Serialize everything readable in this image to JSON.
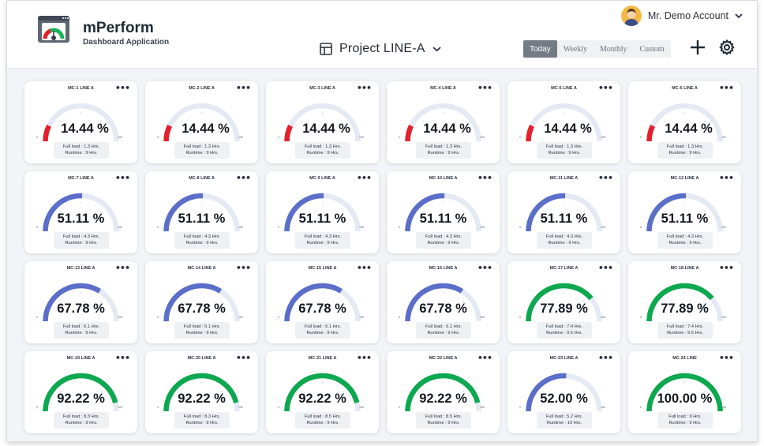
{
  "app": {
    "name": "mPerform",
    "subtitle": "Dashboard Application"
  },
  "account": {
    "name": "Mr. Demo Account",
    "icon": "avatar-icon"
  },
  "project": {
    "name": "Project LINE-A",
    "icon": "layout-icon"
  },
  "range_tabs": [
    "Today",
    "Weekly",
    "Monthly",
    "Custom"
  ],
  "active_range": "Today",
  "colors": {
    "accent_blue": "#5b6ec9",
    "green": "#0da84f",
    "red": "#e3202b",
    "track": "#e4e9f4",
    "page_bg": "#f2f4f7"
  },
  "gauge_scale": {
    "min_label": "0",
    "max_label": "100"
  },
  "cards": [
    {
      "title": "MC-1 LINE A",
      "percent_label": "14.44 %",
      "value": 14.44,
      "color": "red",
      "full_load": "Full load : 1.3 Hrs.",
      "runtime": "Runtime : 9 Hrs."
    },
    {
      "title": "MC-2 LINE A",
      "percent_label": "14.44 %",
      "value": 14.44,
      "color": "red",
      "full_load": "Full load : 1.3 Hrs.",
      "runtime": "Runtime : 9 Hrs."
    },
    {
      "title": "MC-3 LINE A",
      "percent_label": "14.44 %",
      "value": 14.44,
      "color": "red",
      "full_load": "Full load : 1.3 Hrs.",
      "runtime": "Runtime : 9 Hrs."
    },
    {
      "title": "MC-4 LINE A",
      "percent_label": "14.44 %",
      "value": 14.44,
      "color": "red",
      "full_load": "Full load : 1.3 Hrs.",
      "runtime": "Runtime : 9 Hrs."
    },
    {
      "title": "MC-5 LINE A",
      "percent_label": "14.44 %",
      "value": 14.44,
      "color": "red",
      "full_load": "Full load : 1.3 Hrs.",
      "runtime": "Runtime : 9 Hrs."
    },
    {
      "title": "MC-6 LINE A",
      "percent_label": "14.44 %",
      "value": 14.44,
      "color": "red",
      "full_load": "Full load : 1.3 Hrs.",
      "runtime": "Runtime : 9 Hrs."
    },
    {
      "title": "MC-7 LINE A",
      "percent_label": "51.11 %",
      "value": 51.11,
      "color": "blue",
      "full_load": "Full load : 4.3 Hrs.",
      "runtime": "Runtime : 9 Hrs."
    },
    {
      "title": "MC-8 LINE A",
      "percent_label": "51.11 %",
      "value": 51.11,
      "color": "blue",
      "full_load": "Full load : 4.3 Hrs.",
      "runtime": "Runtime : 9 Hrs."
    },
    {
      "title": "MC-9 LINE A",
      "percent_label": "51.11 %",
      "value": 51.11,
      "color": "blue",
      "full_load": "Full load : 4.3 Hrs.",
      "runtime": "Runtime : 9 Hrs."
    },
    {
      "title": "MC-10 LINE A",
      "percent_label": "51.11 %",
      "value": 51.11,
      "color": "blue",
      "full_load": "Full load : 4.3 Hrs.",
      "runtime": "Runtime : 9 Hrs."
    },
    {
      "title": "MC-11 LINE A",
      "percent_label": "51.11 %",
      "value": 51.11,
      "color": "blue",
      "full_load": "Full load : 4.3 Hrs.",
      "runtime": "Runtime : 9 Hrs."
    },
    {
      "title": "MC-12 LINE A",
      "percent_label": "51.11 %",
      "value": 51.11,
      "color": "blue",
      "full_load": "Full load : 4.3 Hrs.",
      "runtime": "Runtime : 9 Hrs."
    },
    {
      "title": "MC-13 LINE A",
      "percent_label": "67.78 %",
      "value": 67.78,
      "color": "blue",
      "full_load": "Full load : 6.1 Hrs.",
      "runtime": "Runtime : 9 Hrs."
    },
    {
      "title": "MC-14 LINE A",
      "percent_label": "67.78 %",
      "value": 67.78,
      "color": "blue",
      "full_load": "Full load : 6.1 Hrs.",
      "runtime": "Runtime : 9 Hrs."
    },
    {
      "title": "MC-15 LINE A",
      "percent_label": "67.78 %",
      "value": 67.78,
      "color": "blue",
      "full_load": "Full load : 6.1 Hrs.",
      "runtime": "Runtime : 9 Hrs."
    },
    {
      "title": "MC-16 LINE A",
      "percent_label": "67.78 %",
      "value": 67.78,
      "color": "blue",
      "full_load": "Full load : 6.1 Hrs.",
      "runtime": "Runtime : 9 Hrs."
    },
    {
      "title": "MC-17 LINE A",
      "percent_label": "77.89 %",
      "value": 77.89,
      "color": "green",
      "full_load": "Full load : 7.4 Hrs.",
      "runtime": "Runtime : 9.5 Hrs."
    },
    {
      "title": "MC-18 LINE A",
      "percent_label": "77.89 %",
      "value": 77.89,
      "color": "green",
      "full_load": "Full load : 7.4 Hrs.",
      "runtime": "Runtime : 9.5 Hrs."
    },
    {
      "title": "MC-19 LINE A",
      "percent_label": "92.22 %",
      "value": 92.22,
      "color": "green",
      "full_load": "Full load : 8.3 Hrs.",
      "runtime": "Runtime : 9 Hrs."
    },
    {
      "title": "MC-20 LINE A",
      "percent_label": "92.22 %",
      "value": 92.22,
      "color": "green",
      "full_load": "Full load : 8.3 Hrs.",
      "runtime": "Runtime : 9 Hrs."
    },
    {
      "title": "MC-21 LINE A",
      "percent_label": "92.22 %",
      "value": 92.22,
      "color": "green",
      "full_load": "Full load : 8.5 Hrs.",
      "runtime": "Runtime : 9 Hrs."
    },
    {
      "title": "MC-22 LINE A",
      "percent_label": "92.22 %",
      "value": 92.22,
      "color": "green",
      "full_load": "Full load : 8.5 Hrs.",
      "runtime": "Runtime : 9 Hrs."
    },
    {
      "title": "MC-23 LINE A",
      "percent_label": "52.00 %",
      "value": 52.0,
      "color": "blue",
      "full_load": "Full load : 5.2 Hrs.",
      "runtime": "Runtime : 10 Hrs."
    },
    {
      "title": "MC-24 LINE",
      "percent_label": "100.00 %",
      "value": 100.0,
      "color": "green",
      "full_load": "Full load : 9 Hrs.",
      "runtime": "Runtime : 9 Hrs."
    }
  ]
}
